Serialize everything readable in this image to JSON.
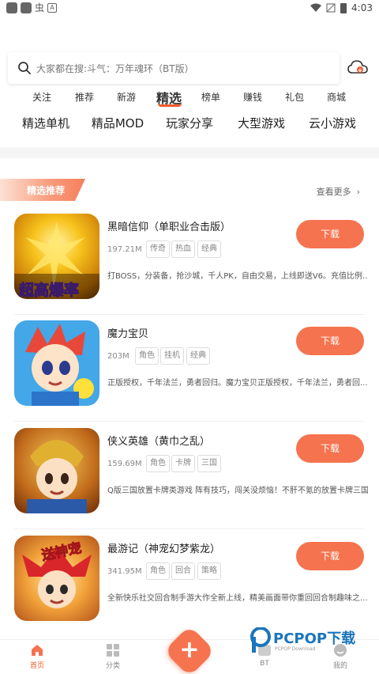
{
  "status_bar": {
    "time": "4:03",
    "app_glyph": "虫"
  },
  "search": {
    "placeholder": "大家都在搜:斗气：万年魂环（BT版）"
  },
  "nav_tabs": [
    "关注",
    "推荐",
    "新游",
    "精选",
    "榜单",
    "赚钱",
    "礼包",
    "商城"
  ],
  "active_tab": "精选",
  "sub_tabs": [
    "精选单机",
    "精品MOD",
    "玩家分享",
    "大型游戏",
    "云小游戏"
  ],
  "section": {
    "title": "精选推荐",
    "see_more": "查看更多"
  },
  "games": [
    {
      "name": "黑暗信仰（单职业合击版）",
      "size": "197.21M",
      "tags": [
        "传奇",
        "热血",
        "经典"
      ],
      "desc": "打BOSS，分装备，抢沙城，千人PK，自由交易，上线即送V6。充值比例...",
      "button": "下载",
      "icon_caption": "超高爆率"
    },
    {
      "name": "魔力宝贝",
      "size": "203M",
      "tags": [
        "角色",
        "挂机",
        "经典"
      ],
      "desc": "正版授权，千年法兰，勇者回归。魔力宝贝正版授权，千年法兰，勇者回...",
      "button": "下载",
      "icon_caption": ""
    },
    {
      "name": "侠义英雄（黄巾之乱）",
      "size": "159.69M",
      "tags": [
        "角色",
        "卡牌",
        "三国"
      ],
      "desc": "Q版三国放置卡牌类游戏 阵有技巧，闯关没烦恼！不肝不氪的放置卡牌三国...",
      "button": "下载",
      "icon_caption": ""
    },
    {
      "name": "最游记（神宠幻梦紫龙）",
      "size": "341.95M",
      "tags": [
        "角色",
        "回合",
        "策略"
      ],
      "desc": "全新快乐社交回合制手游大作全新上线，精美画面带你重回回合制趣味之...",
      "button": "下载",
      "icon_caption": "送神宠"
    }
  ],
  "bottom_nav": [
    {
      "label": "首页",
      "icon": "home-icon",
      "active": true
    },
    {
      "label": "分类",
      "icon": "grid-icon",
      "active": false
    },
    {
      "label": "BT",
      "icon": "bt-icon",
      "active": false
    },
    {
      "label": "我的",
      "icon": "user-icon",
      "active": false
    }
  ],
  "fab": {
    "label": "+"
  },
  "watermark": {
    "text": "PCPOP下载",
    "sub": "PCPOP Download"
  },
  "colors": {
    "accent": "#f5734f",
    "active_tab_underline": "#f05a2c",
    "watermark": "#1b75bb"
  }
}
